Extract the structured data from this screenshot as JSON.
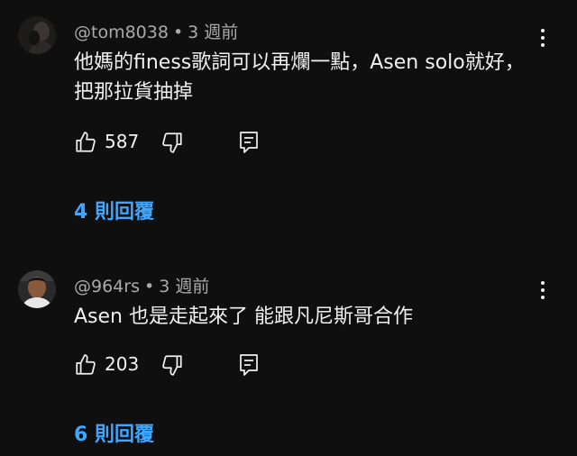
{
  "comments": [
    {
      "author": "@tom8038",
      "separator": "•",
      "time": "3 週前",
      "text": "他媽的finess歌詞可以再爛一點，Asen solo就好，把那拉貨抽掉",
      "likes": "587",
      "replies_label": "4 則回覆",
      "avatar": "user-avatar-dark"
    },
    {
      "author": "@964rs",
      "separator": "•",
      "time": "3 週前",
      "text": "Asen 也是走起來了 能跟凡尼斯哥合作",
      "likes": "203",
      "replies_label": "6 則回覆",
      "avatar": "user-avatar-portrait"
    }
  ],
  "icons": {
    "like": "thumbs-up-icon",
    "dislike": "thumbs-down-icon",
    "reply": "comment-reply-icon",
    "more": "more-vertical-icon"
  },
  "colors": {
    "background": "#0f0f0f",
    "text_primary": "#f1f1f1",
    "text_secondary": "#aaaaaa",
    "link": "#3ea6ff"
  }
}
